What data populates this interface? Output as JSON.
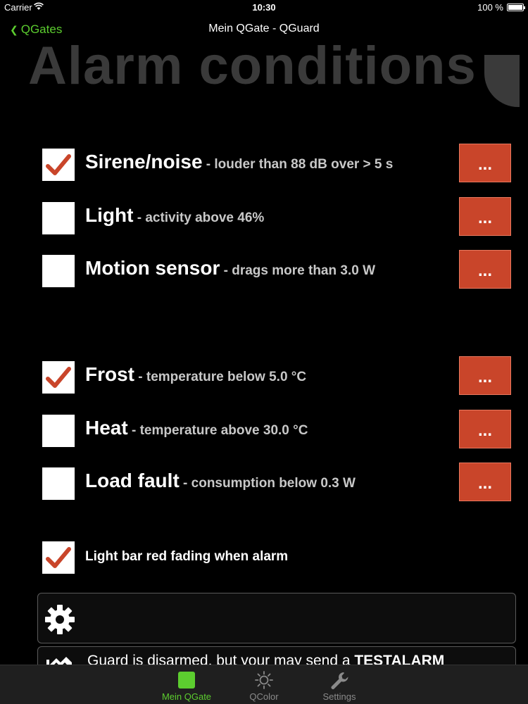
{
  "status_bar": {
    "carrier": "Carrier",
    "time": "10:30",
    "battery": "100 %"
  },
  "nav": {
    "back_label": "QGates",
    "title": "Mein QGate  - QGuard"
  },
  "heading": "Alarm conditions",
  "alarms": [
    {
      "name": "Sirene/noise",
      "sep": " - ",
      "desc": "louder than 88 dB over > 5 s",
      "checked": true,
      "button": "..."
    },
    {
      "name": "Light",
      "sep": " - ",
      "desc": "activity above 46%",
      "checked": false,
      "button": "..."
    },
    {
      "name": "Motion sensor",
      "sep": " - ",
      "desc": "drags more than 3.0 W",
      "checked": false,
      "button": "..."
    },
    {
      "name": "Frost",
      "sep": " - ",
      "desc": "temperature below 5.0 °C",
      "checked": true,
      "button": "..."
    },
    {
      "name": "Heat",
      "sep": " - ",
      "desc": "temperature above 30.0 °C",
      "checked": false,
      "button": "..."
    },
    {
      "name": "Load fault",
      "sep": " - ",
      "desc": "consumption below 0.3 W",
      "checked": false,
      "button": "..."
    }
  ],
  "light_bar_option": {
    "label": "Light bar red fading when alarm",
    "checked": true
  },
  "status_message": {
    "text": "Guard is disarmed, but your may send a ",
    "emphasis": "TESTALARM"
  },
  "tabs": [
    {
      "label": "Mein QGate",
      "icon": "square-icon",
      "active": true
    },
    {
      "label": "QColor",
      "icon": "sun-icon",
      "active": false
    },
    {
      "label": "Settings",
      "icon": "wrench-icon",
      "active": false
    }
  ],
  "colors": {
    "accent_green": "#5ccd2f",
    "button_red": "#c9452a",
    "check_red": "#c9452a",
    "heading_gray": "#3a3a3a"
  }
}
